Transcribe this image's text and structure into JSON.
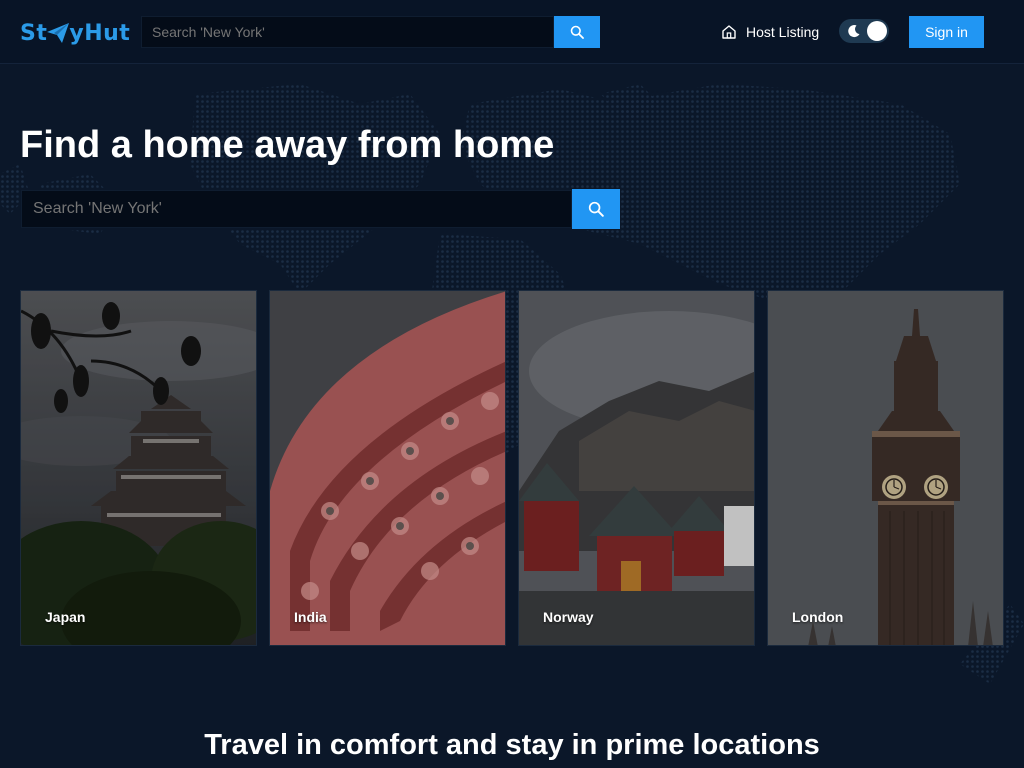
{
  "header": {
    "logo_text": "StayHut",
    "search": {
      "placeholder": "Search 'New York'"
    },
    "host_listing_label": "Host Listing",
    "signin_label": "Sign in"
  },
  "hero": {
    "title": "Find a home away from home",
    "search": {
      "placeholder": "Search 'New York'"
    }
  },
  "destinations": [
    {
      "label": "Japan"
    },
    {
      "label": "India"
    },
    {
      "label": "Norway"
    },
    {
      "label": "London"
    }
  ],
  "section_title": "Travel in comfort and stay in prime locations",
  "colors": {
    "accent": "#2196f3",
    "background": "#0b1729",
    "logo": "#2b9be8"
  },
  "icons": {
    "search": "search-icon",
    "home": "home-icon",
    "moon": "moon-icon",
    "plane": "paper-plane-icon"
  }
}
